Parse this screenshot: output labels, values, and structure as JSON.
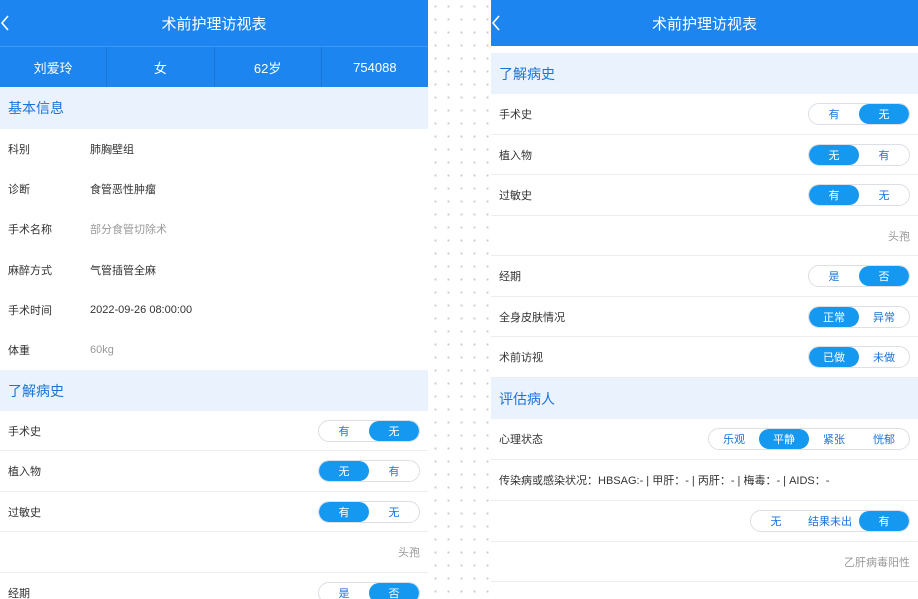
{
  "app": {
    "title": "术前护理访视表"
  },
  "patient": {
    "name": "刘爱玲",
    "gender": "女",
    "age": "62岁",
    "id": "754088"
  },
  "basic_info": {
    "heading": "基本信息",
    "rows": [
      {
        "label": "科别",
        "value": "肺胸壁组"
      },
      {
        "label": "诊断",
        "value": "食管恶性肿瘤"
      },
      {
        "label": "手术名称",
        "value": "部分食管切除术"
      },
      {
        "label": "麻醉方式",
        "value": "气管插管全麻"
      },
      {
        "label": "手术时间",
        "value": "2022-09-26 08:00:00"
      },
      {
        "label": "体重",
        "value": "60kg"
      }
    ]
  },
  "history": {
    "heading": "了解病史",
    "surgery": {
      "label": "手术史",
      "options": [
        "有",
        "无"
      ],
      "selected": "无"
    },
    "implant": {
      "label": "植入物",
      "options": [
        "无",
        "有"
      ],
      "selected": "无"
    },
    "allergy": {
      "label": "过敏史",
      "options": [
        "有",
        "无"
      ],
      "selected": "有"
    },
    "allergy_note": "头孢",
    "menstruation": {
      "label": "经期",
      "options": [
        "是",
        "否"
      ],
      "selected": "否"
    },
    "skin": {
      "label": "全身皮肤情况",
      "options": [
        "正常",
        "异常"
      ],
      "selected": "正常"
    },
    "visit": {
      "label": "术前访视",
      "options": [
        "已做",
        "未做"
      ],
      "selected": "已做"
    }
  },
  "assessment": {
    "heading": "评估病人",
    "mental": {
      "label": "心理状态",
      "options": [
        "乐观",
        "平静",
        "紧张",
        "恍郁"
      ],
      "selected": "平静"
    },
    "infection_text": "传染病或感染状况：HBSAG:- | 甲肝：- | 丙肝：- | 梅毒：- | AIDS：-",
    "infection": {
      "options": [
        "无",
        "结果未出",
        "有"
      ],
      "selected": "有"
    },
    "infection_note": "乙肝病毒阳性"
  }
}
